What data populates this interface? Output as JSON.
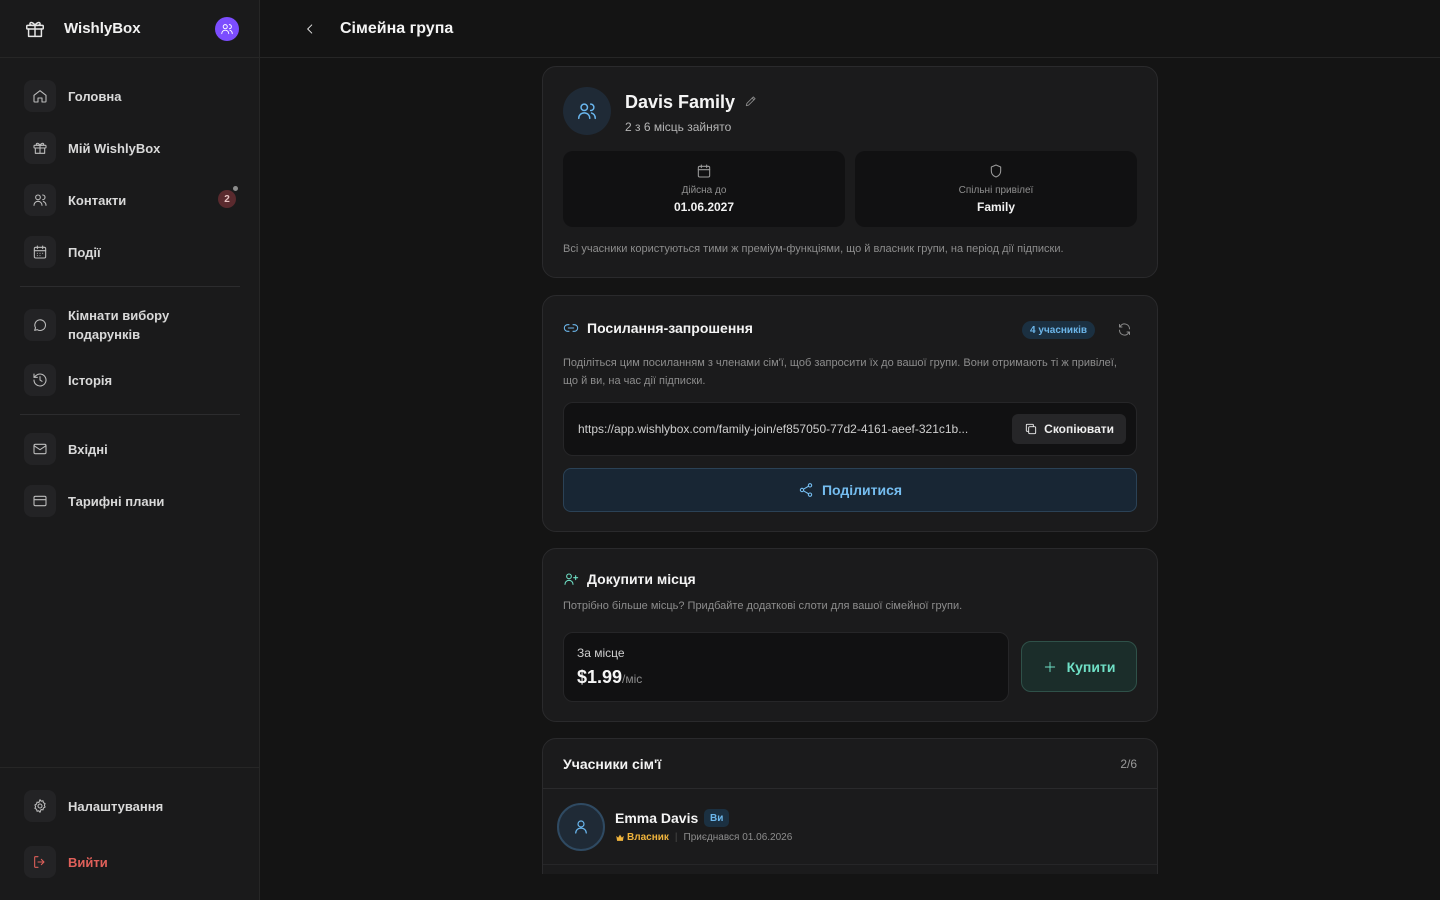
{
  "app": {
    "brand": "WishlyBox"
  },
  "sidebar": {
    "items": [
      {
        "label": "Головна",
        "icon": "home-icon"
      },
      {
        "label": "Мій WishlyBox",
        "icon": "gift-icon"
      },
      {
        "label": "Контакти",
        "icon": "users-icon",
        "badge": "2"
      },
      {
        "label": "Події",
        "icon": "calendar-icon"
      },
      {
        "label": "Кімнати вибору подарунків",
        "icon": "chat-icon"
      },
      {
        "label": "Історія",
        "icon": "history-icon"
      },
      {
        "label": "Вхідні",
        "icon": "mail-icon"
      },
      {
        "label": "Тарифні плани",
        "icon": "credit-card-icon"
      }
    ],
    "settings_label": "Налаштування",
    "logout_label": "Вийти"
  },
  "header": {
    "title": "Сімейна група"
  },
  "group": {
    "name": "Davis Family",
    "seats": "2 з 6 місць зайнято",
    "valid_label": "Дійсна до",
    "valid_value": "01.06.2027",
    "perks_label": "Спільні привілеї",
    "perks_value": "Family",
    "note": "Всі учасники користуються тими ж преміум-функціями, що й власник групи, на період дії підписки."
  },
  "invite": {
    "title": "Посилання-запрошення",
    "members_pill": "4 учасників",
    "description": "Поділіться цим посиланням з членами сім'ї, щоб запросити їх до вашої групи. Вони отримають ті ж привілеї, що й ви, на час дії підписки.",
    "link": "https://app.wishlybox.com/family-join/ef857050-77d2-4161-aeef-321c1b...",
    "copy_label": "Скопіювати",
    "share_label": "Поділитися"
  },
  "buy": {
    "title": "Докупити місця",
    "description": "Потрібно більше місць? Придбайте додаткові слоти для вашої сімейної групи.",
    "price_label": "За місце",
    "price": "$1.99",
    "price_unit": "/міс",
    "buy_label": "Купити"
  },
  "members": {
    "title": "Учасники сім'ї",
    "count": "2/6",
    "list": [
      {
        "name": "Emma Davis",
        "you_badge": "Ви",
        "role": "Власник",
        "joined": "Приєднався 01.06.2026"
      }
    ]
  },
  "colors": {
    "accent_blue": "#6cb6ea",
    "accent_green": "#6fe0c6",
    "owner_gold": "#f0b43c",
    "danger": "#e0605a",
    "avatar_purple": "#7c4dff"
  }
}
